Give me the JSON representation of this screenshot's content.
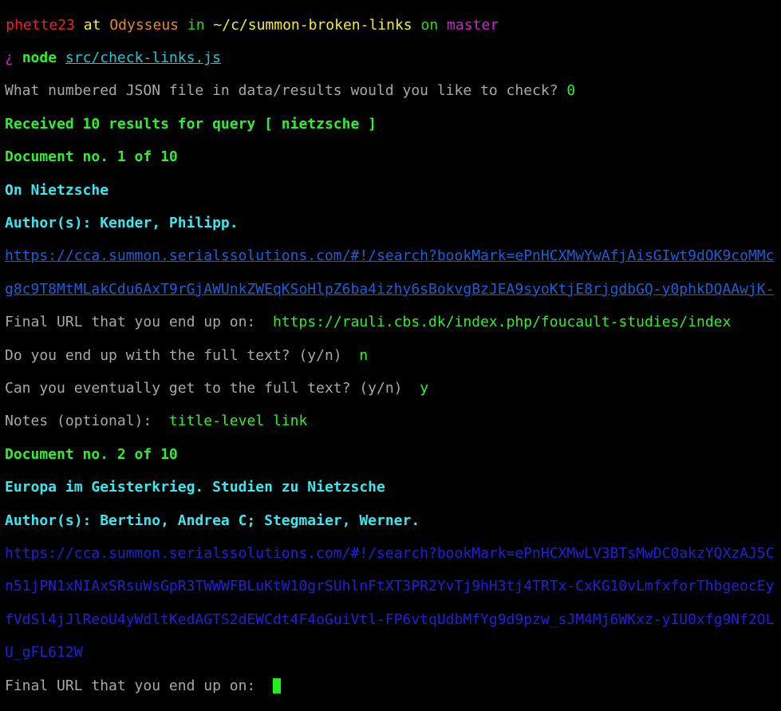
{
  "prompt": {
    "marker": "▸",
    "user": "phette23",
    "at": "at",
    "host": "Odysseus",
    "in": "in",
    "path": "~/c/summon-broken-links",
    "on": "on",
    "branch": "master"
  },
  "command": {
    "symbol": "¿",
    "cmd": "node",
    "arg": "src/check-links.js"
  },
  "lines": {
    "question": "What numbered JSON file in data/results would you like to check?",
    "answer": "0",
    "received": "Received 10 results for query [ nietzsche ]",
    "doc1": "Document no. 1 of 10",
    "title1": "On Nietzsche",
    "author1": "Author(s): Kender, Philipp.",
    "url1a": "https://cca.summon.serialssolutions.com/#!/search?bookMark=ePnHCXMwYwAfjAisGIwt9dOK9coMMc",
    "url1b": "g8c9T8MtMLakCdu6AxT9rGjAWUnkZWEqKSoHlpZ6ba4izhy6sBokvgBzJEA9syoKtjE8rjgdbGQ-y0phkDQAAwjK-",
    "final_label": "Final URL that you end up on:",
    "final1": "https://rauli.cbs.dk/index.php/foucault-studies/index",
    "full_q": "Do you end up with the full text? (y/n)",
    "full_a": "n",
    "even_q": "Can you eventually get to the full text? (y/n)",
    "even_a": "y",
    "notes_q": "Notes (optional):",
    "notes_a": "title-level link",
    "doc2": "Document no. 2 of 10",
    "title2": "Europa im Geisterkrieg. Studien zu Nietzsche",
    "author2": "Author(s): Bertino, Andrea C; Stegmaier, Werner.",
    "url2a": "https://cca.summon.serialssolutions.com/#!/search?bookMark=ePnHCXMwLV3BTsMwDC0akzYQXzAJ5C",
    "url2b": "n51jPN1xNIAxSRsuWsGpR3TWWWFBLuKtW10grSUhlnFtXT3PR2YvTj9hH3tj4TRTx-CxKG10vLmfxforThbgeocEy",
    "url2c": "fVdSl4jJlReoU4yWdltKedAGTS2dEWCdt4F4oGuiVtl-FP6vtqUdbMfYg9d9pzw_sJM4Mj6WKxz-yIU0xfg9Nf2OL",
    "url2d": "U_gFL612W"
  }
}
